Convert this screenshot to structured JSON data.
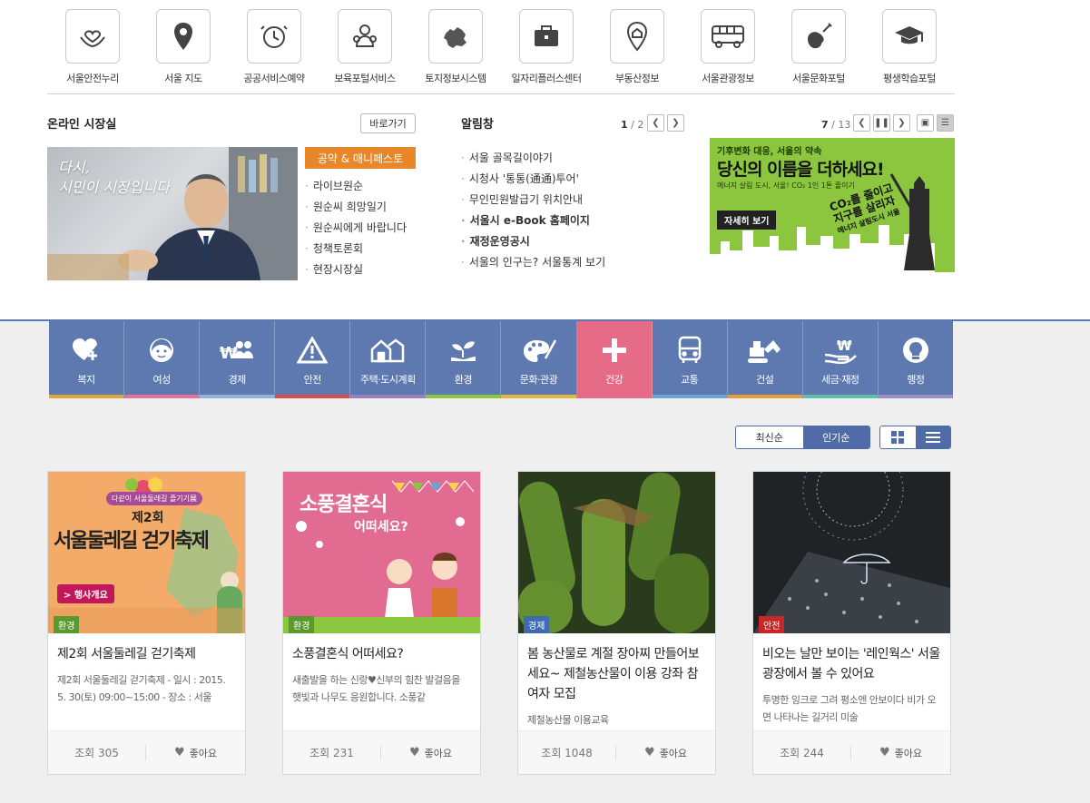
{
  "shortcuts": [
    {
      "label": "서울안전누리",
      "icon": "heart-hands-icon"
    },
    {
      "label": "서울 지도",
      "icon": "map-pin-icon"
    },
    {
      "label": "공공서비스예약",
      "icon": "alarm-clock-icon"
    },
    {
      "label": "보육포털서비스",
      "icon": "child-icon"
    },
    {
      "label": "토지정보시스템",
      "icon": "seoul-map-icon"
    },
    {
      "label": "일자리플러스센터",
      "icon": "briefcase-icon"
    },
    {
      "label": "부동산정보",
      "icon": "house-pin-icon"
    },
    {
      "label": "서울관광정보",
      "icon": "bus-icon"
    },
    {
      "label": "서울문화포털",
      "icon": "guitar-icon"
    },
    {
      "label": "평생학습포털",
      "icon": "graduation-cap-icon"
    }
  ],
  "mayor": {
    "title": "온라인 시장실",
    "goto": "바로가기",
    "photo_text_line1": "다시,",
    "photo_text_line2": "시민이 시장입니다",
    "manifesto": "공약 & 매니페스토",
    "links": [
      "라이브원순",
      "원순씨 희망일기",
      "원순씨에게 바랍니다",
      "청책토론회",
      "현장시장실"
    ]
  },
  "notice": {
    "title": "알림창",
    "page_current": "1",
    "page_total": "/ 2",
    "links": [
      {
        "text": "서울 골목길이야기",
        "bold": false
      },
      {
        "text": "시청사 '통통(通通)투어'",
        "bold": false
      },
      {
        "text": "무인민원발급기 위치안내",
        "bold": false
      },
      {
        "text": "서울시 e-Book 홈페이지",
        "bold": true
      },
      {
        "text": "재정운영공시",
        "bold": true
      },
      {
        "text": "서울의 인구는? 서울통계 보기",
        "bold": false
      }
    ]
  },
  "banner": {
    "page_current": "7",
    "page_total": "/ 13",
    "sub": "기후변화 대응, 서울의 약속",
    "main": "당신의 이름을 더하세요!",
    "small": "에너지 살림 도시, 서울! CO₂ 1인 1톤 줄이기",
    "more": "자세히 보기",
    "slogan_line1": "CO₂를 줄이고",
    "slogan_line2": "지구를 살리자",
    "slogan_line3": "에너지 살림도시 서울"
  },
  "categories": [
    {
      "label": "복지",
      "icon": "heart-plus-icon",
      "color": "#e0a83a"
    },
    {
      "label": "여성",
      "icon": "woman-icon",
      "color": "#e6719a"
    },
    {
      "label": "경제",
      "icon": "won-people-icon",
      "color": "#8fb3dc"
    },
    {
      "label": "안전",
      "icon": "warning-icon",
      "color": "#d94a4a"
    },
    {
      "label": "주택·도시계획",
      "icon": "houses-icon",
      "color": "#9a7fbf"
    },
    {
      "label": "환경",
      "icon": "sprout-hand-icon",
      "color": "#8cc63f"
    },
    {
      "label": "문화·관광",
      "icon": "palette-icon",
      "color": "#e3b841"
    },
    {
      "label": "건강",
      "icon": "plus-icon",
      "color": "#e56b86"
    },
    {
      "label": "교통",
      "icon": "bus-front-icon",
      "color": "#6aa5d8"
    },
    {
      "label": "건설",
      "icon": "excavator-icon",
      "color": "#e89b3a"
    },
    {
      "label": "세금·재정",
      "icon": "won-hand-icon",
      "color": "#5fc0a9"
    },
    {
      "label": "행정",
      "icon": "lightbulb-icon",
      "color": "#9b8ec8"
    }
  ],
  "active_category": "건강",
  "sort": {
    "latest": "최신순",
    "popular": "인기순"
  },
  "cards": [
    {
      "tag": "환경",
      "tag_color": "#5a9a2c",
      "image_text_top": "다같이 서울둘레길 즐기기展",
      "image_text_main1": "제2회",
      "image_text_main2": "서울둘레길 걷기축제",
      "image_badge": "> 행사개요",
      "title": "제2회 서울둘레길 걷기축제",
      "desc": "제2회 서울둘레길 걷기축제 - 일시 : 2015. 5. 30(토) 09:00~15:00 - 장소 : 서울",
      "views": "조회 305",
      "like": "좋아요"
    },
    {
      "tag": "환경",
      "tag_color": "#5a9a2c",
      "image_text_main1": "소풍결혼식",
      "image_text_main2": "어떠세요?",
      "title": "소풍결혼식 어떠세요?",
      "desc": "새출발을 하는 신랑♥신부의 힘찬 발걸음을 햇빛과 나무도 응원합니다. 소풍같",
      "views": "조회 231",
      "like": "좋아요"
    },
    {
      "tag": "경제",
      "tag_color": "#3f6bb0",
      "title": "봄 농산물로 계절 장아찌 만들어보세요~ 제철농산물이 이용 강좌 참여자 모집",
      "desc": "제철농산물 이용교육",
      "views": "조회 1048",
      "like": "좋아요"
    },
    {
      "tag": "안전",
      "tag_color": "#c62828",
      "title": "비오는 날만 보이는 '레인웍스' 서울광장에서 볼 수 있어요",
      "desc": "투명한 잉크로 그려 평소엔 안보이다 비가 오면 나타나는 길거리 미술",
      "views": "조회 244",
      "like": "좋아요"
    }
  ]
}
